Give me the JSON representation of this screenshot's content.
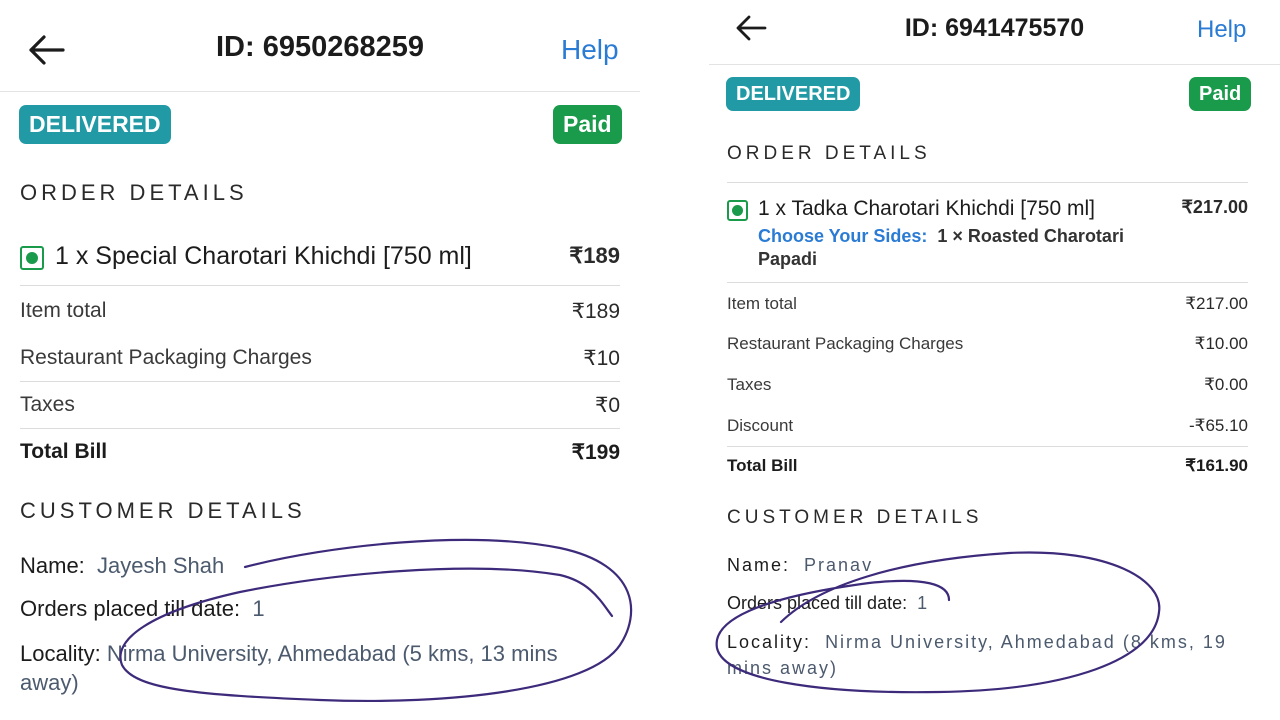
{
  "left": {
    "order_id": "ID: 6950268259",
    "help": "Help",
    "status": "DELIVERED",
    "payment": "Paid",
    "order_section": "ORDER DETAILS",
    "item_name": "1 x Special Charotari Khichdi [750 ml]",
    "item_price": "₹189",
    "bill": [
      {
        "label": "Item total",
        "value": "₹189"
      },
      {
        "label": "Restaurant Packaging Charges",
        "value": "₹10"
      },
      {
        "label": "Taxes",
        "value": "₹0"
      }
    ],
    "total_label": "Total Bill",
    "total_value": "₹199",
    "customer_section": "CUSTOMER DETAILS",
    "name_label": "Name:",
    "name_value": "Jayesh Shah",
    "orders_label": "Orders placed till date:",
    "orders_value": "1",
    "locality_label": "Locality:",
    "locality_value": "Nirma University, Ahmedabad (5 kms, 13 mins away)"
  },
  "right": {
    "order_id": "ID: 6941475570",
    "help": "Help",
    "status": "DELIVERED",
    "payment": "Paid",
    "order_section": "ORDER DETAILS",
    "item_name": "1 x Tadka Charotari Khichdi [750 ml]",
    "item_price": "₹217.00",
    "sides_label": "Choose Your Sides:",
    "sides_value": "1 × Roasted Charotari Papadi",
    "bill": [
      {
        "label": "Item total",
        "value": "₹217.00"
      },
      {
        "label": "Restaurant Packaging Charges",
        "value": "₹10.00"
      },
      {
        "label": "Taxes",
        "value": "₹0.00"
      },
      {
        "label": "Discount",
        "value": "-₹65.10"
      }
    ],
    "total_label": "Total Bill",
    "total_value": "₹161.90",
    "customer_section": "CUSTOMER DETAILS",
    "name_label": "Name:",
    "name_value": "Pranav",
    "orders_label": "Orders placed till date:",
    "orders_value": "1",
    "locality_label": "Locality:",
    "locality_value": "Nirma University, Ahmedabad (8 kms, 19 mins away)"
  },
  "colors": {
    "delivered_badge": "#229aa5",
    "paid_badge": "#1a9a4b",
    "help_link": "#2a7bd4",
    "sides_label": "#2a7bd4",
    "customer_value": "#4c5a6e",
    "pen_ink": "#3d2a7a"
  },
  "icons": [
    "back-arrow-icon",
    "veg-indicator-icon"
  ]
}
